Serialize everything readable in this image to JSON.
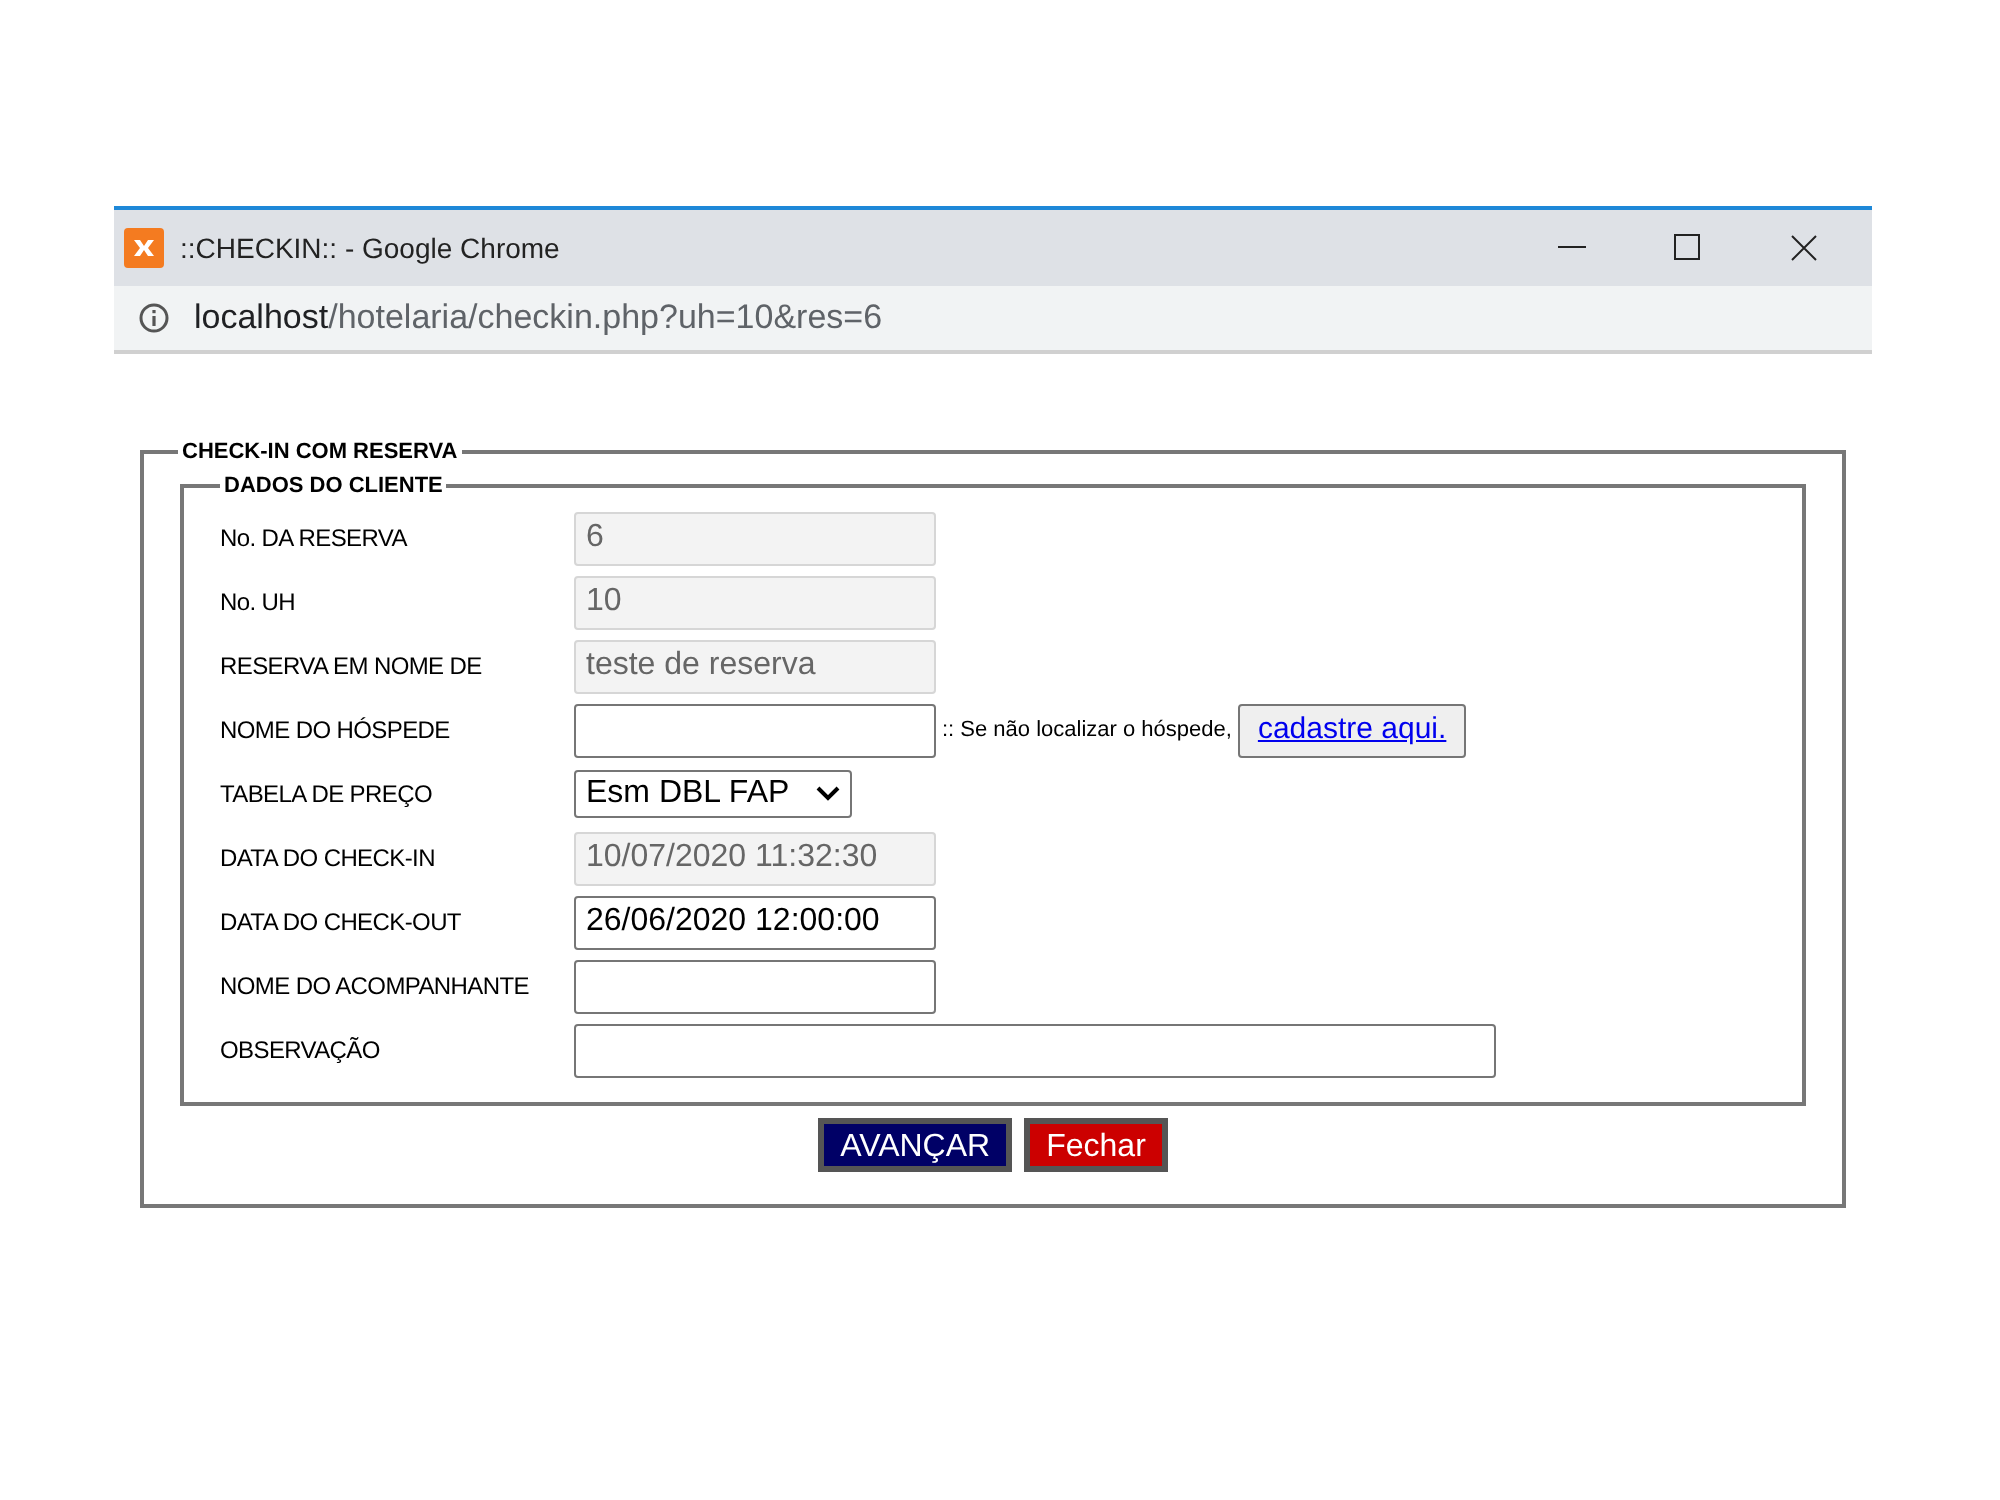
{
  "window": {
    "title": "::CHECKIN:: - Google Chrome",
    "url_host": "localhost",
    "url_path": "/hotelaria/checkin.php?uh=10&res=6"
  },
  "form": {
    "legend": "CHECK-IN COM RESERVA",
    "section": {
      "legend": "DADOS DO CLIENTE",
      "fields": [
        {
          "kind": "readonly",
          "label": "No. DA RESERVA",
          "value": "6"
        },
        {
          "kind": "readonly",
          "label": "No. UH",
          "value": "10"
        },
        {
          "kind": "readonly",
          "label": "RESERVA EM NOME DE",
          "value": "teste de reserva"
        },
        {
          "kind": "input_with_link",
          "label": "NOME DO HÓSPEDE",
          "note": ":: Se não localizar o hóspede,",
          "link": "cadastre aqui."
        },
        {
          "kind": "select",
          "label": "TABELA DE PREÇO",
          "value": "Esm DBL FAP"
        },
        {
          "kind": "readonly",
          "label": "DATA DO CHECK-IN",
          "value": "10/07/2020 11:32:30"
        },
        {
          "kind": "input",
          "label": "DATA DO CHECK-OUT",
          "value": "26/06/2020 12:00:00"
        },
        {
          "kind": "input",
          "label": "NOME DO ACOMPANHANTE"
        },
        {
          "kind": "wide",
          "label": "OBSERVAÇÃO"
        }
      ]
    },
    "buttons": [
      {
        "kind": "primary",
        "label": "AVANÇAR"
      },
      {
        "kind": "danger",
        "label": "Fechar"
      }
    ]
  }
}
